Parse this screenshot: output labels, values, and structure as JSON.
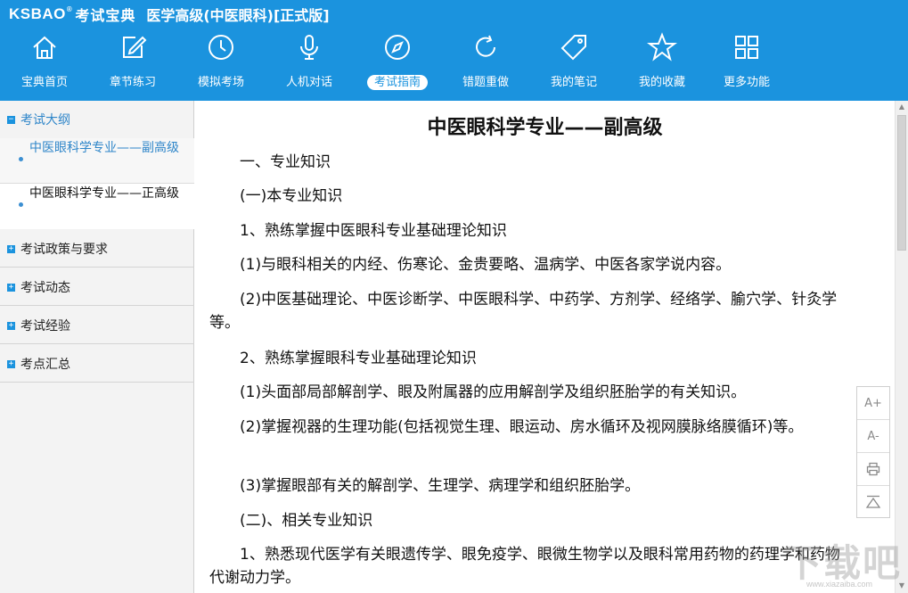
{
  "app": {
    "logo": "KSBAO",
    "logo_cn": "考试宝典",
    "title": "医学高级(中医眼科)[正式版]"
  },
  "nav": [
    {
      "label": "宝典首页",
      "icon": "home-icon"
    },
    {
      "label": "章节练习",
      "icon": "edit-icon"
    },
    {
      "label": "模拟考场",
      "icon": "clock-icon"
    },
    {
      "label": "人机对话",
      "icon": "microphone-icon"
    },
    {
      "label": "考试指南",
      "icon": "compass-icon",
      "active": true
    },
    {
      "label": "错题重做",
      "icon": "refresh-icon"
    },
    {
      "label": "我的笔记",
      "icon": "tag-icon"
    },
    {
      "label": "我的收藏",
      "icon": "star-icon"
    },
    {
      "label": "更多功能",
      "icon": "grid-icon"
    }
  ],
  "sidebar": {
    "sections": [
      {
        "label": "考试大纲",
        "expanded": true,
        "children": [
          {
            "label": "中医眼科学专业——副高级"
          },
          {
            "label": "中医眼科学专业——正高级",
            "selected": true
          }
        ]
      },
      {
        "label": "考试政策与要求"
      },
      {
        "label": "考试动态"
      },
      {
        "label": "考试经验"
      },
      {
        "label": "考点汇总"
      }
    ]
  },
  "content": {
    "title": "中医眼科学专业——副高级",
    "paragraphs": [
      "　　一、专业知识",
      "　　(一)本专业知识",
      "　　1、熟练掌握中医眼科专业基础理论知识",
      "　　(1)与眼科相关的内经、伤寒论、金贵要略、温病学、中医各家学说内容。",
      "　　(2)中医基础理论、中医诊断学、中医眼科学、中药学、方剂学、经络学、腧穴学、针灸学等。",
      "　　2、熟练掌握眼科专业基础理论知识",
      "　　(1)头面部局部解剖学、眼及附属器的应用解剖学及组织胚胎学的有关知识。",
      "　　(2)掌握视器的生理功能(包括视觉生理、眼运动、房水循环及视网膜脉络膜循环)等。",
      "　　(3)掌握眼部有关的解剖学、生理学、病理学和组织胚胎学。",
      "　　(二)、相关专业知识",
      "　　1、熟悉现代医学有关眼遗传学、眼免疫学、眼微生物学以及眼科常用药物的药理学和药物代谢动力学。"
    ]
  },
  "tools": {
    "font_increase": "A+",
    "font_decrease": "A-",
    "print_icon": "print-icon",
    "top_icon": "back-to-top-icon"
  },
  "watermark": "下载吧",
  "watermark_sub": "www.xiazaiba.com",
  "colors": {
    "header": "#1b93de",
    "link": "#2f86c9"
  }
}
